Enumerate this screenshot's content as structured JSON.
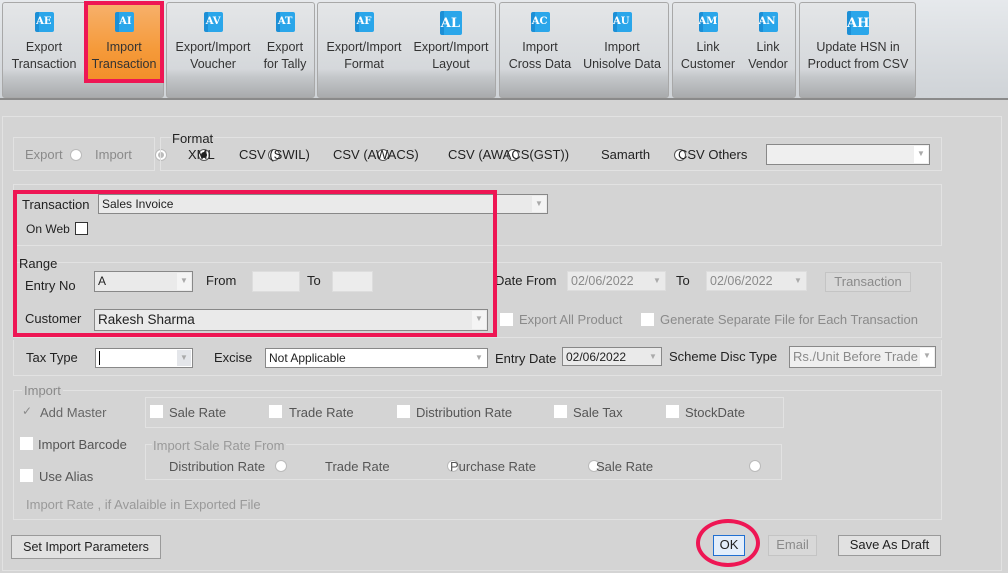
{
  "ribbon": {
    "groups": [
      {
        "buttons": [
          {
            "label1": "Export",
            "label2": "Transaction",
            "icon": "AE",
            "icon_name": "export-transaction-icon"
          },
          {
            "label1": "Import",
            "label2": "Transaction",
            "icon": "AI",
            "icon_name": "import-transaction-icon",
            "active": true
          }
        ]
      },
      {
        "buttons": [
          {
            "label1": "Export/Import",
            "label2": "Voucher",
            "icon": "AV"
          },
          {
            "label1": "Export",
            "label2": "for Tally",
            "icon": "AT"
          }
        ]
      },
      {
        "buttons": [
          {
            "label1": "Export/Import",
            "label2": "Format",
            "icon": "AF"
          },
          {
            "label1": "Export/Import",
            "label2": "Layout",
            "icon": "AL"
          }
        ]
      },
      {
        "buttons": [
          {
            "label1": "Import",
            "label2": "Cross Data",
            "icon": "AC"
          },
          {
            "label1": "Import",
            "label2": "Unisolve Data",
            "icon": "AU"
          }
        ]
      },
      {
        "buttons": [
          {
            "label1": "Link",
            "label2": "Customer",
            "icon": "AM"
          },
          {
            "label1": "Link",
            "label2": "Vendor",
            "icon": "AN"
          }
        ]
      },
      {
        "buttons": [
          {
            "label1": "Update HSN in",
            "label2": "Product from CSV",
            "icon": "AH"
          }
        ]
      }
    ]
  },
  "mode": {
    "export_label": "Export",
    "import_label": "Import",
    "selected": "Import"
  },
  "format": {
    "title": "Format",
    "options": [
      "XML",
      "CSV (SWIL)",
      "CSV (AWACS)",
      "CSV (AWACS(GST))",
      "Samarth",
      "CSV Others"
    ],
    "selected": "XML",
    "others_value": ""
  },
  "transaction": {
    "label": "Transaction",
    "value": "Sales Invoice",
    "on_web_label": "On Web",
    "on_web_checked": false
  },
  "range": {
    "title": "Range",
    "entry_no_label": "Entry No",
    "entry_no_value": "A",
    "from_label": "From",
    "from_value": "",
    "to_label": "To",
    "to_value": "",
    "date_from_label": "Date From",
    "date_from_value": "02/06/2022",
    "date_to_label": "To",
    "date_to_value": "02/06/2022",
    "transaction_button": "Transaction",
    "customer_label": "Customer",
    "customer_value": "Rakesh Sharma",
    "export_all_product_label": "Export All Product",
    "separate_file_label": "Generate Separate File for Each Transaction"
  },
  "row_tax": {
    "tax_type_label": "Tax Type",
    "tax_type_value": "",
    "excise_label": "Excise",
    "excise_value": "Not Applicable",
    "entry_date_label": "Entry Date",
    "entry_date_value": "02/06/2022",
    "scheme_label": "Scheme Disc Type",
    "scheme_value": "Rs./Unit Before Trade"
  },
  "import_section": {
    "title": "Import",
    "add_master_label": "Add Master",
    "add_master_checked": true,
    "rates": [
      "Sale Rate",
      "Trade Rate",
      "Distribution Rate",
      "Sale Tax",
      "StockDate"
    ],
    "import_barcode_label": "Import Barcode",
    "use_alias_label": "Use Alias",
    "sale_rate_from_title": "Import Sale Rate From",
    "sale_rate_from_options": [
      "Distribution Rate",
      "Trade Rate",
      "Purchase Rate",
      "Sale Rate"
    ],
    "note": "Import Rate , if Avalaible in Exported File"
  },
  "footer": {
    "set_params_label": "Set Import Parameters",
    "ok_label": "OK",
    "email_label": "Email",
    "save_draft_label": "Save As Draft"
  },
  "colors": {
    "highlight": "#ee1654",
    "active_ribbon": "#f59a3a"
  }
}
